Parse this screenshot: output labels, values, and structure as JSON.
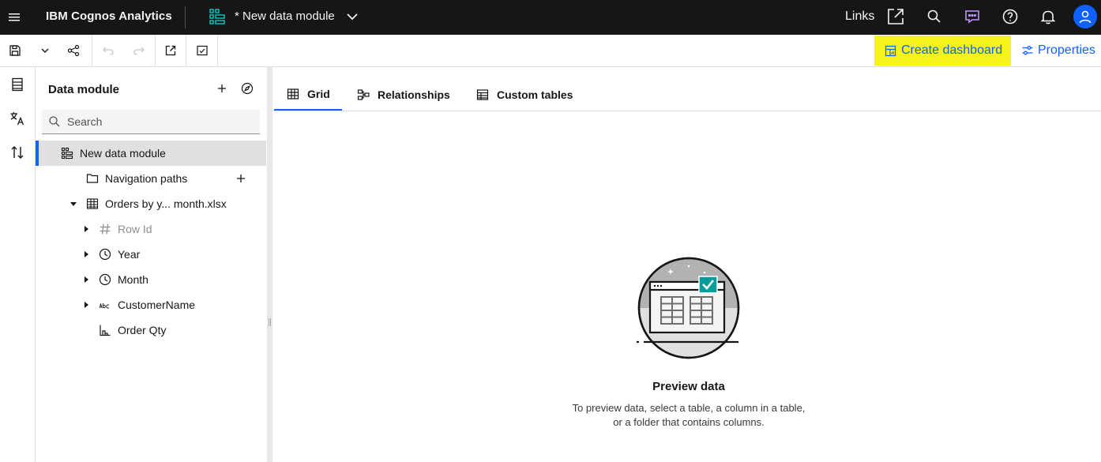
{
  "header": {
    "brand": "IBM Cognos Analytics",
    "module_title": "* New data module",
    "links_label": "Links"
  },
  "toolbar": {
    "create_dashboard_label": "Create dashboard",
    "properties_label": "Properties",
    "highlight_color": "#f5f31a"
  },
  "panel": {
    "title": "Data module",
    "search_placeholder": "Search",
    "tree": [
      {
        "label": "New data module",
        "icon": "data-module-icon",
        "selected": true
      },
      {
        "label": "Navigation paths",
        "icon": "folder-icon"
      },
      {
        "label": "Orders by y... month.xlsx",
        "icon": "table-icon",
        "expanded": true
      },
      {
        "label": "Row Id",
        "icon": "hash-icon",
        "muted": true
      },
      {
        "label": "Year",
        "icon": "clock-icon"
      },
      {
        "label": "Month",
        "icon": "clock-icon"
      },
      {
        "label": "CustomerName",
        "icon": "abc-icon"
      },
      {
        "label": "Order Qty",
        "icon": "measure-icon"
      }
    ]
  },
  "main": {
    "tabs": [
      {
        "label": "Grid",
        "active": true
      },
      {
        "label": "Relationships"
      },
      {
        "label": "Custom tables"
      }
    ],
    "preview_title": "Preview data",
    "preview_description": "To preview data, select a table, a column in a table, or a folder that contains columns."
  },
  "colors": {
    "accent": "#0f62fe",
    "topbar": "#161616",
    "teal": "#009d9a"
  }
}
